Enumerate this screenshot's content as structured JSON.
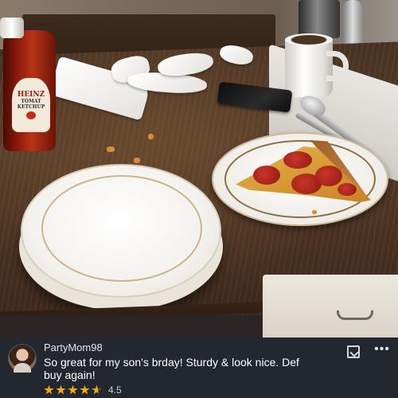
{
  "photo": {
    "bottle_label": {
      "brand": "HEINZ",
      "line1": "TOMAT",
      "line2": "KETCHUP"
    }
  },
  "review": {
    "username": "PartyMom98",
    "comment": "So great for my son's brday! Sturdy & look nice. Def buy again!",
    "rating_value": "4.5",
    "rating_stars": 4.5,
    "star_color": "#f3a712",
    "actions": {
      "report_icon": "report-icon",
      "more_icon": "more-icon",
      "more_glyph": "•••"
    }
  },
  "colors": {
    "comment_bar_bg": "#232830",
    "text_primary": "#ffffff"
  }
}
